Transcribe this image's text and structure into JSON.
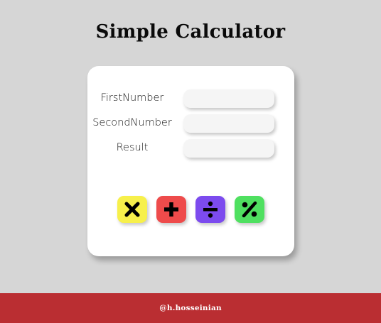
{
  "page": {
    "title": "Simple Calculator"
  },
  "form": {
    "fields": [
      {
        "label": "FirstNumber",
        "value": "",
        "placeholder": ""
      },
      {
        "label": "SecondNumber",
        "value": "",
        "placeholder": ""
      },
      {
        "label": "Result",
        "value": "",
        "placeholder": ""
      }
    ]
  },
  "buttons": [
    {
      "icon": "multiply-icon",
      "color": "#f7f04b"
    },
    {
      "icon": "plus-icon",
      "color": "#ee4b4b"
    },
    {
      "icon": "divide-icon",
      "color": "#7c4bee"
    },
    {
      "icon": "percent-icon",
      "color": "#4fe060"
    }
  ],
  "footer": {
    "credit": "@h.hosseinian",
    "color": "#ba2e32"
  },
  "colors": {
    "background": "#d6d6d6",
    "card": "#ffffff"
  }
}
